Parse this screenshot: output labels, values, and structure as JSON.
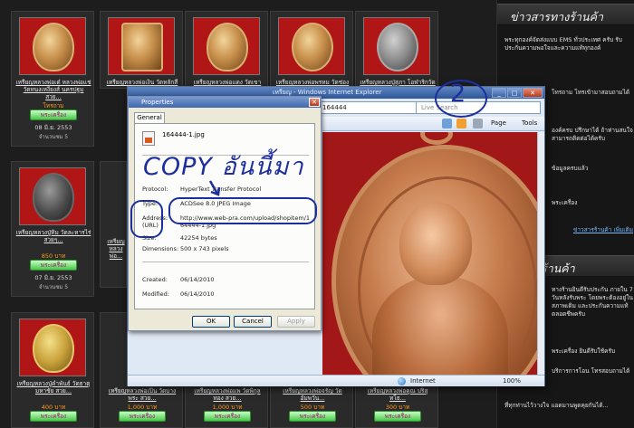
{
  "shop": {
    "buy_label": "พระเครื่อง",
    "row1": [
      {
        "title": "เหรียญหลวงพ่อเต๋ หลวงพ่อแช่ วัดทนงเหงี่ยงส์ นครปฐม สวย...",
        "price": "โทรถาม",
        "date": "08 มิ.ย. 2553",
        "views": "จำนวนชม 5"
      },
      {
        "title": "เหรียญหลวงพ่อเงิน วัดหลักสี่ สวยงาม...",
        "price": "",
        "date": "",
        "views": ""
      },
      {
        "title": "เหรียญหลวงพ่อแดง วัดเขาบันไดอิฐ 2513 สวย...",
        "price": "",
        "date": "",
        "views": ""
      },
      {
        "title": "เหรียญหลวงพ่อพรหม วัดช่องแค 2513 สวย...",
        "price": "",
        "date": "",
        "views": ""
      },
      {
        "title": "เหรียญหลวงปู่สุภา โอฬาริกวัดสีลสุภาราม...",
        "price": "",
        "date": "",
        "views": ""
      }
    ],
    "row2": [
      {
        "title": "เหรียญหลวงปู่ทิม วัดละหารไร่ สวยๆ...",
        "price": "850 บาท",
        "date": "07 มิ.ย. 2553",
        "views": "จำนวนชม 5"
      },
      {
        "title": "เหรียญหลวงพ่อ...",
        "price": "",
        "date": "",
        "views": ""
      }
    ],
    "row3": [
      {
        "title": "เหรียญหลวงปู่คำพันธ์ วัดธาตุมหาชัย สวย...",
        "price": "400 บาท"
      },
      {
        "title": "เหรียญหลวงพ่อเปิ่น วัดบางพระ สวย...",
        "price": "1,000 บาท"
      },
      {
        "title": "เหรียญหลวงพ่อแพ วัดพิกุลทอง สวย...",
        "price": "1,000 บาท"
      },
      {
        "title": "เหรียญหลวงพ่อจรัญ วัดอัมพวัน...",
        "price": "500 บาท"
      },
      {
        "title": "เหรียญหลวงพ่อคูณ ปริสุทโธ...",
        "price": "300 บาท"
      }
    ]
  },
  "sidebar": {
    "news_head": "ข่าวสารทางร้านค้า",
    "news_text": "พระทุกองค์จัดส่งแบบ EMS ทั่วประเทศ ครับ รับประกันความพอใจและความแท้ทุกองค์",
    "news_text2": "โทรถาม โทรเข้ามาสอบถามได้",
    "news_text3": "องค์ครบ ปรึกษาได้ ถ้าท่านสนใจ สามารถติดต่อได้ครับ",
    "news_text4": "ข้อมูลครบแล้ว",
    "news_text5": "พระเครื่อง",
    "more_link": "ข่าวสารร้านค้า เพิ่มเติม",
    "shop_head": "ร้านค้า",
    "shop_text": "ทางร้านยินดีรับประกัน ภายใน 7 วันหลังรับพระ โดยพระต้องอยู่ในสภาพเดิม และประกันความแท้ตลอดชีพครับ",
    "shop_text2": "พระเครื่อง ยินดีรับใช้ครับ",
    "shop_text3": "บริการการโอน โทรสอบถามได้",
    "shop_text4": "ที่ทุกท่านไว้วางใจ แอดมานพูดคุยกันได้..."
  },
  "browser": {
    "title": "เหรียญ - Windows Internet Explorer",
    "address": "164444",
    "search_placeholder": "Live Search",
    "page_menu": "Page",
    "tools_menu": "Tools",
    "status_zone": "Internet",
    "zoom": "100%"
  },
  "dialog": {
    "title": "Properties",
    "tab_general": "General",
    "file_name": "164444-1.jpg",
    "protocol_label": "Protocol:",
    "protocol_value": "HyperText Transfer Protocol",
    "type_label": "Type:",
    "type_value": "ACDSee 8.0 JPEG Image",
    "address_label": "Address:",
    "address_label2": "(URL)",
    "address_value": "http://www.web-pra.com/upload/shopitem/164444-1.jpg",
    "size_label": "Size:",
    "size_value": "42254 bytes",
    "dim_label": "Dimensions:",
    "dim_value": "500 x 743 pixels",
    "created_label": "Created:",
    "created_value": "06/14/2010",
    "modified_label": "Modified:",
    "modified_value": "06/14/2010",
    "ok": "OK",
    "cancel": "Cancel",
    "apply": "Apply"
  },
  "annotation": {
    "copy_text": "COPY อันนี้มา",
    "step_number": "2",
    "color": "#1d2f9e"
  }
}
